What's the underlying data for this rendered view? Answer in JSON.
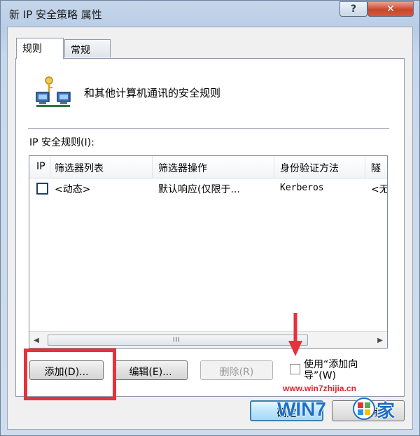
{
  "window": {
    "title": "新 IP 安全策略 属性",
    "help_button": "?",
    "close_button": "✕"
  },
  "tabs": [
    {
      "label": "规则",
      "active": true
    },
    {
      "label": "常规",
      "active": false
    }
  ],
  "header": {
    "icon": "network-computers-key-icon",
    "text": "和其他计算机通讯的安全规则"
  },
  "rules_label": "IP 安全规则(I):",
  "list": {
    "columns": [
      "IP",
      "筛选器列表",
      "筛选器操作",
      "身份验证方法",
      "隧"
    ],
    "rows": [
      {
        "checked": false,
        "filter_list": "<动态>",
        "filter_action": "默认响应(仅限于...",
        "auth_method": "Kerberos",
        "tunnel": "<无"
      }
    ],
    "scroll_grip": "III"
  },
  "buttons": {
    "add": "添加(D)...",
    "edit": "编辑(E)...",
    "remove": "删除(R)",
    "ok": "确定",
    "cancel": "取消"
  },
  "wizard_checkbox": {
    "label": "使用“添加向导”(W)",
    "checked": false
  },
  "watermark": {
    "url": "www.win7zhijia.cn",
    "logo_text": "WIN7之家"
  },
  "colors": {
    "annotation_red": "#e5323c",
    "title_bar": "#c0d3ea"
  }
}
